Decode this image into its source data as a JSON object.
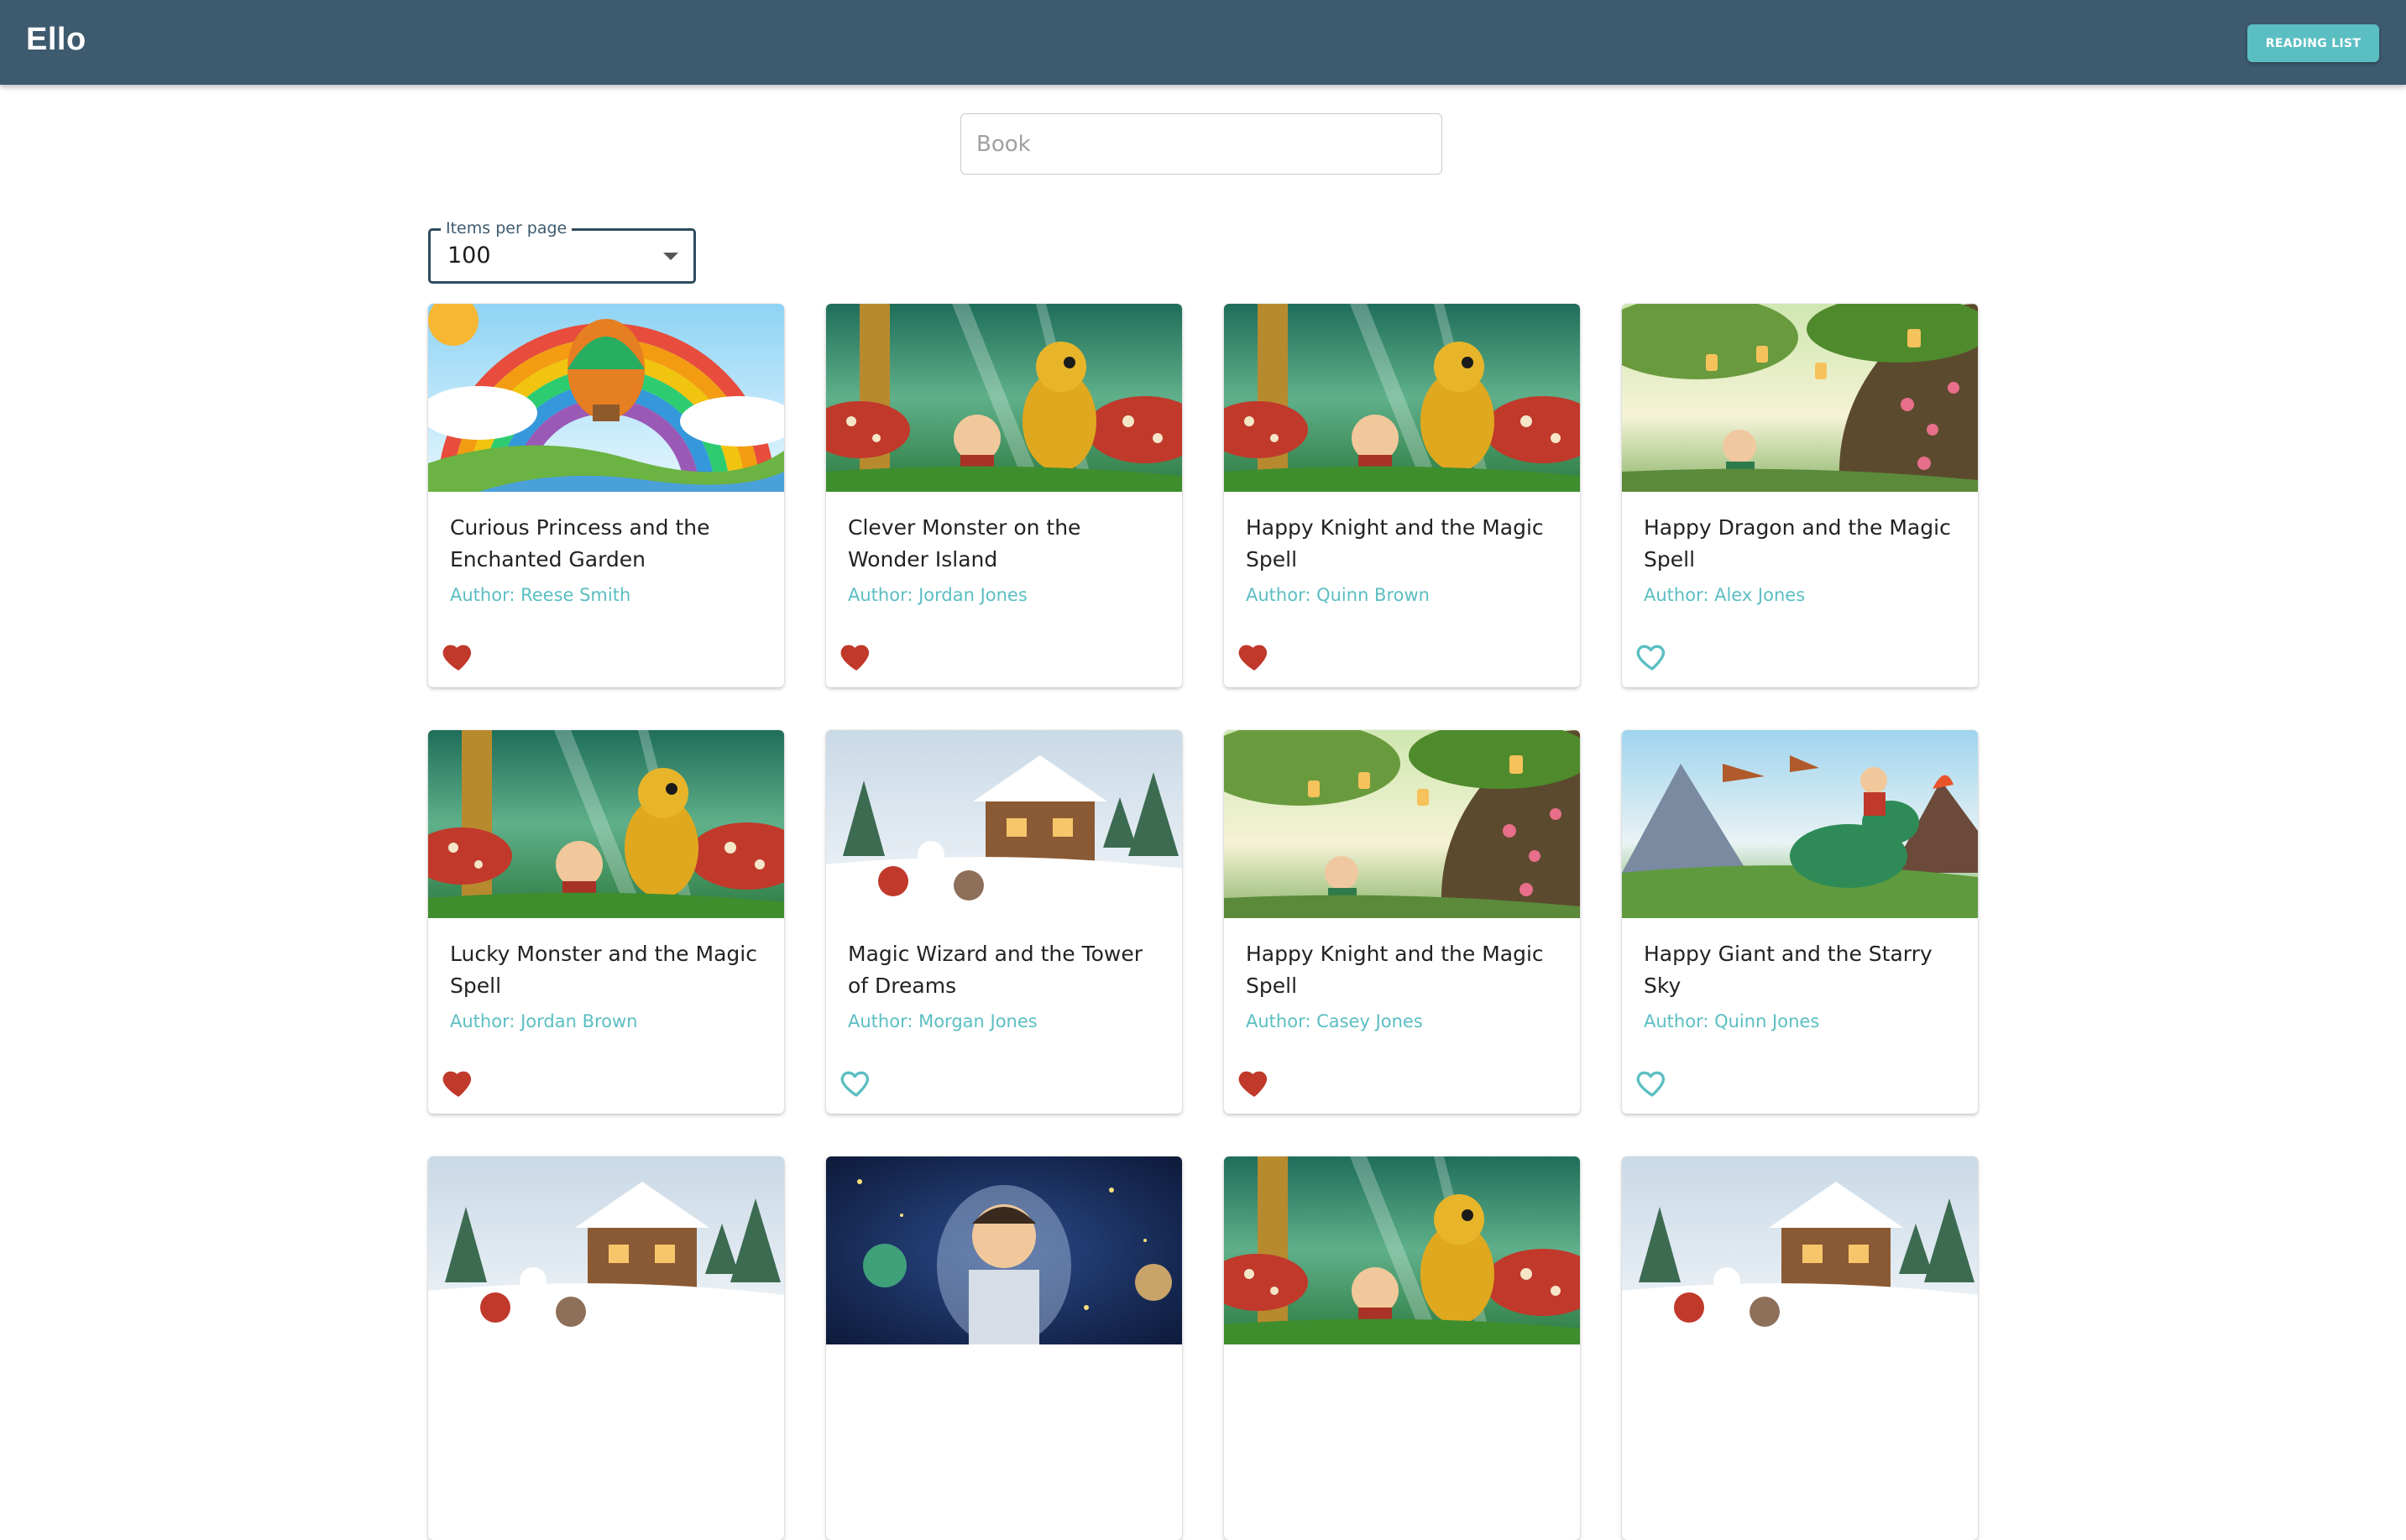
{
  "app": {
    "title": "Ello",
    "reading_list_label": "READING LIST"
  },
  "search": {
    "placeholder": "Book",
    "value": ""
  },
  "pagination": {
    "label": "Items per page",
    "value": "100"
  },
  "colors": {
    "appbar": "#3d5a6e",
    "accent": "#5bbec2",
    "favorite": "#c0392b"
  },
  "books": [
    {
      "title": "Curious Princess and the Enchanted Garden",
      "author": "Author: Reese Smith",
      "favorite": true,
      "cover": "balloon-rainbow"
    },
    {
      "title": "Clever Monster on the Wonder Island",
      "author": "Author: Jordan Jones",
      "favorite": true,
      "cover": "forest-dragon"
    },
    {
      "title": "Happy Knight and the Magic Spell",
      "author": "Author: Quinn Brown",
      "favorite": true,
      "cover": "forest-dragon"
    },
    {
      "title": "Happy Dragon and the Magic Spell",
      "author": "Author: Alex Jones",
      "favorite": false,
      "cover": "lantern-tree"
    },
    {
      "title": "Lucky Monster and the Magic Spell",
      "author": "Author: Jordan Brown",
      "favorite": true,
      "cover": "forest-dragon"
    },
    {
      "title": "Magic Wizard and the Tower of Dreams",
      "author": "Author: Morgan Jones",
      "favorite": false,
      "cover": "snow-cabin"
    },
    {
      "title": "Happy Knight and the Magic Spell",
      "author": "Author: Casey Jones",
      "favorite": true,
      "cover": "lantern-tree"
    },
    {
      "title": "Happy Giant and the Starry Sky",
      "author": "Author: Quinn Jones",
      "favorite": false,
      "cover": "dinosaur-volcano"
    },
    {
      "title": "",
      "author": "",
      "favorite": false,
      "cover": "snow-cabin"
    },
    {
      "title": "",
      "author": "",
      "favorite": false,
      "cover": "space-astronaut"
    },
    {
      "title": "",
      "author": "",
      "favorite": false,
      "cover": "forest-dragon"
    },
    {
      "title": "",
      "author": "",
      "favorite": false,
      "cover": "snow-cabin"
    }
  ]
}
